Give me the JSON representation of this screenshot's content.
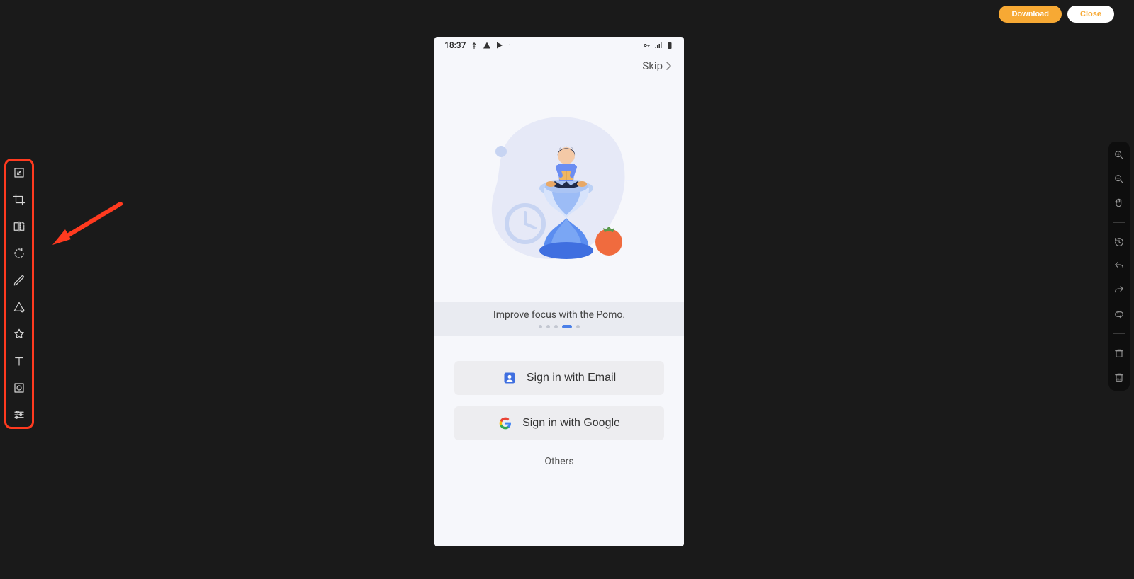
{
  "top_buttons": {
    "download": "Download",
    "close": "Close"
  },
  "left_tools": [
    "resize",
    "crop",
    "flip",
    "rotate",
    "draw",
    "shape",
    "star",
    "text",
    "frame",
    "adjust"
  ],
  "right_tools": [
    "zoom-in",
    "zoom-out",
    "pan",
    "divider",
    "history",
    "undo",
    "redo",
    "loop",
    "divider",
    "trash",
    "clear-all"
  ],
  "phone": {
    "status": {
      "time": "18:37"
    },
    "skip": "Skip",
    "caption": "Improve focus with the Pomo.",
    "pager": {
      "count": 5,
      "active": 3
    },
    "signin_email": "Sign in with Email",
    "signin_google": "Sign in with Google",
    "others": "Others"
  }
}
